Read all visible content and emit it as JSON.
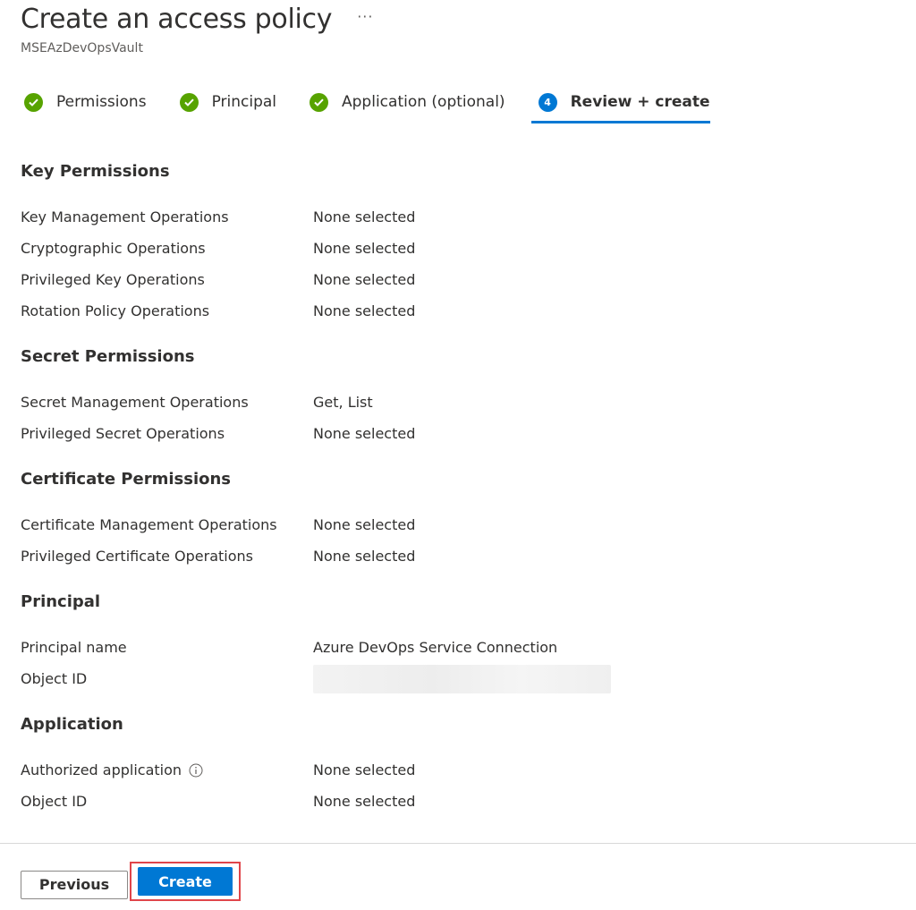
{
  "header": {
    "title": "Create an access policy",
    "more": "···",
    "subtitle": "MSEAzDevOpsVault"
  },
  "wizard": {
    "steps": [
      {
        "label": "Permissions",
        "status": "complete"
      },
      {
        "label": "Principal",
        "status": "complete"
      },
      {
        "label": "Application (optional)",
        "status": "complete"
      },
      {
        "label": "Review + create",
        "number": "4",
        "status": "active"
      }
    ]
  },
  "sections": {
    "key": {
      "title": "Key Permissions",
      "rows": [
        {
          "label": "Key Management Operations",
          "value": "None selected"
        },
        {
          "label": "Cryptographic Operations",
          "value": "None selected"
        },
        {
          "label": "Privileged Key Operations",
          "value": "None selected"
        },
        {
          "label": "Rotation Policy Operations",
          "value": "None selected"
        }
      ]
    },
    "secret": {
      "title": "Secret Permissions",
      "rows": [
        {
          "label": "Secret Management Operations",
          "value": "Get, List"
        },
        {
          "label": "Privileged Secret Operations",
          "value": "None selected"
        }
      ]
    },
    "certificate": {
      "title": "Certificate Permissions",
      "rows": [
        {
          "label": "Certificate Management Operations",
          "value": "None selected"
        },
        {
          "label": "Privileged Certificate Operations",
          "value": "None selected"
        }
      ]
    },
    "principal": {
      "title": "Principal",
      "rows": [
        {
          "label": "Principal name",
          "value": "Azure DevOps Service Connection"
        },
        {
          "label": "Object ID",
          "value": ""
        }
      ]
    },
    "application": {
      "title": "Application",
      "rows": [
        {
          "label": "Authorized application",
          "value": "None selected"
        },
        {
          "label": "Object ID",
          "value": "None selected"
        }
      ]
    }
  },
  "footer": {
    "previous_label": "Previous",
    "create_label": "Create"
  },
  "colors": {
    "accent": "#0078d4",
    "success": "#57a300",
    "highlight": "#e0454a"
  },
  "icons": {
    "step_complete": "checkmark-circle-icon",
    "info": "info-icon",
    "more": "ellipsis-icon"
  }
}
